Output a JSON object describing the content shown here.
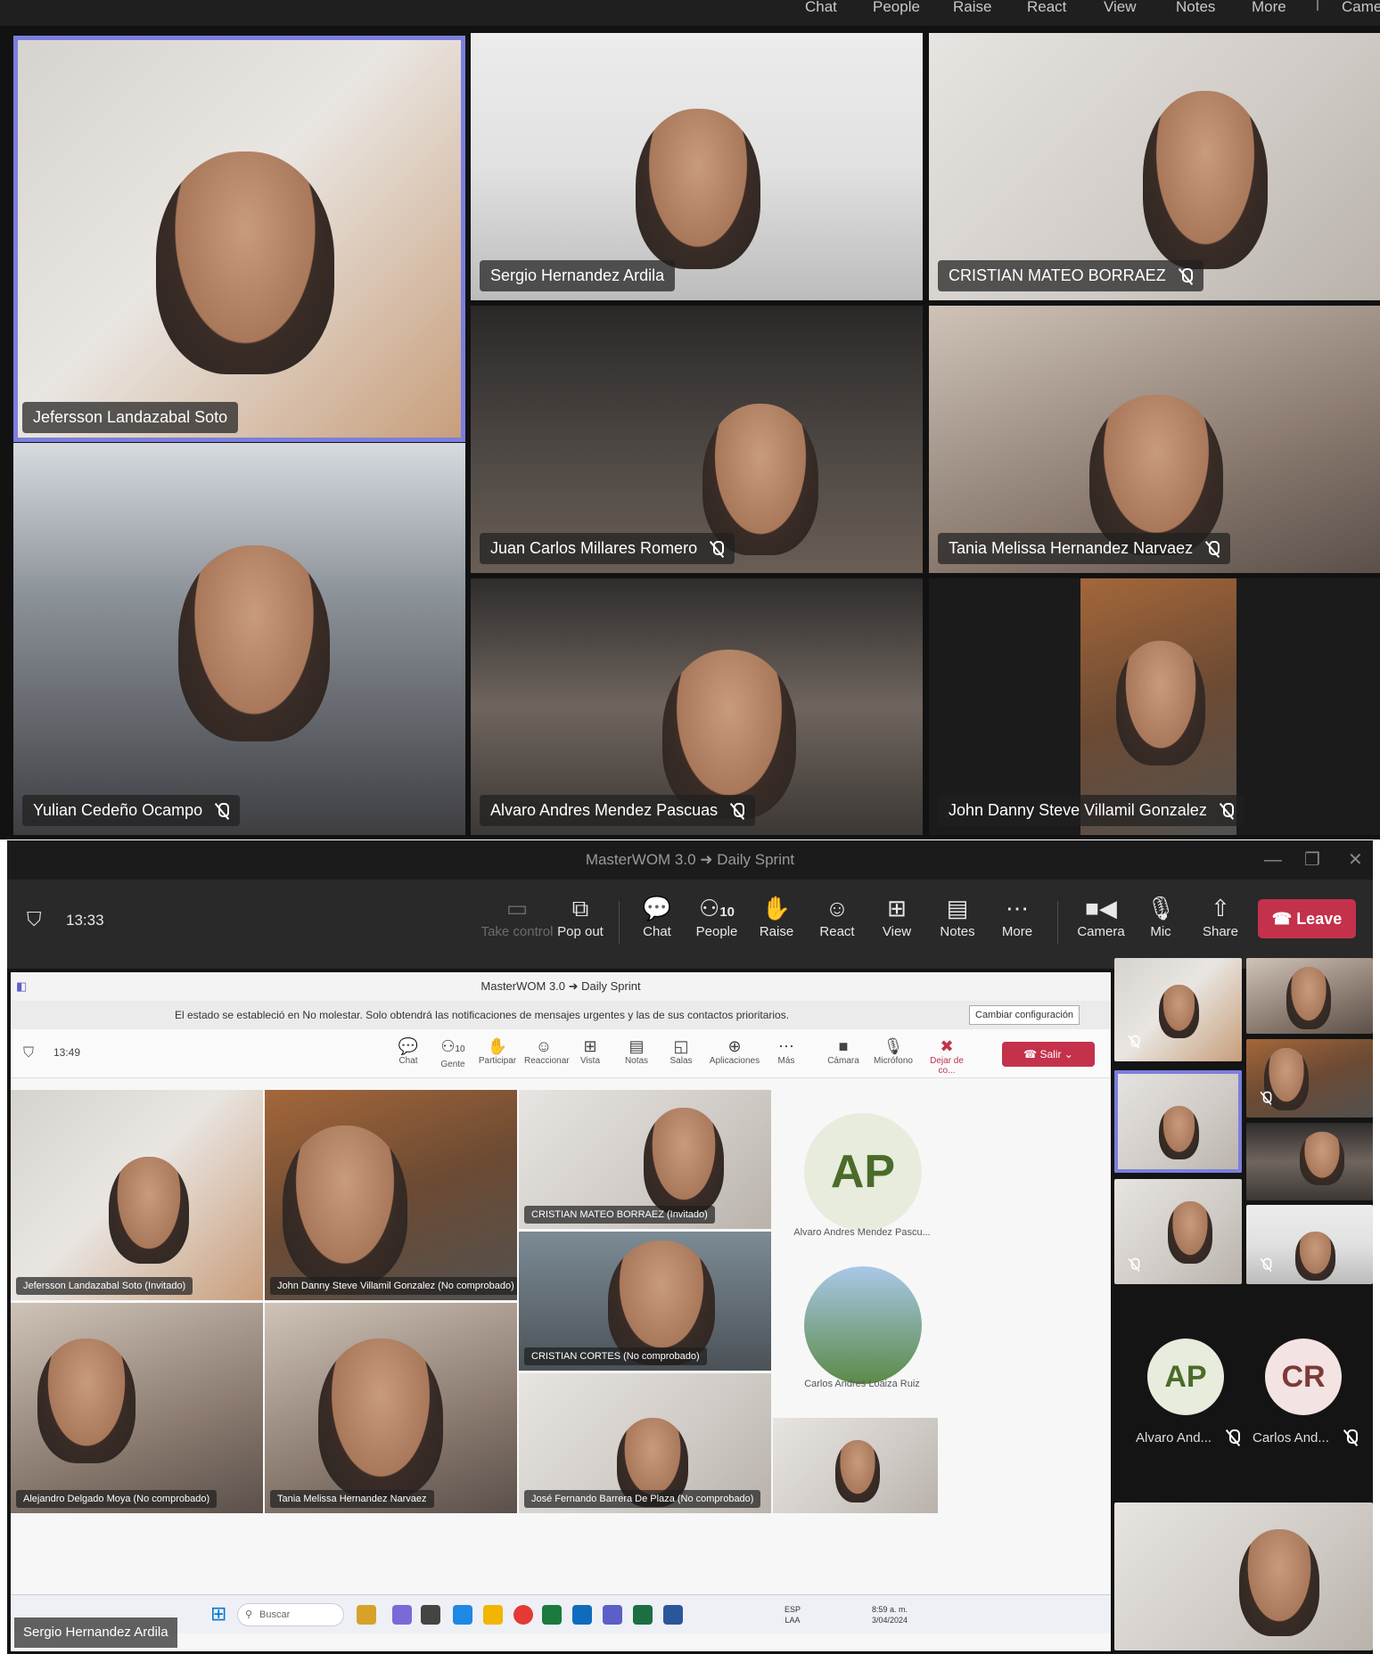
{
  "top_toolbar": {
    "items": [
      "Chat",
      "People",
      "Raise",
      "React",
      "View",
      "Notes",
      "More",
      "Came"
    ]
  },
  "top_grid": {
    "participants": [
      {
        "name": "Jefersson Landazabal Soto",
        "muted": false,
        "active_speaker": true
      },
      {
        "name": "Sergio Hernandez Ardila",
        "muted": false
      },
      {
        "name": "CRISTIAN MATEO BORRAEZ",
        "muted": true
      },
      {
        "name": "Juan Carlos Millares Romero",
        "muted": true
      },
      {
        "name": "Tania Melissa Hernandez Narvaez",
        "muted": true
      },
      {
        "name": "Yulian Cedeño Ocampo",
        "muted": true
      },
      {
        "name": "Alvaro Andres Mendez Pascuas",
        "muted": true
      },
      {
        "name": "John Danny Steve Villamil Gonzalez",
        "muted": true
      }
    ]
  },
  "window": {
    "title": "MasterWOM 3.0 ➜ Daily Sprint",
    "controls": [
      "—",
      "❐",
      "✕"
    ]
  },
  "meeting_toolbar": {
    "timer": "13:33",
    "people_count": "10",
    "buttons": {
      "take_control": "Take control",
      "pop_out": "Pop out",
      "chat": "Chat",
      "people": "People",
      "raise": "Raise",
      "react": "React",
      "view": "View",
      "notes": "Notes",
      "more": "More",
      "camera": "Camera",
      "mic": "Mic",
      "share": "Share",
      "leave": "Leave"
    }
  },
  "shared_screen": {
    "title": "MasterWOM 3.0 ➜ Daily Sprint",
    "banner_text": "El estado se estableció en No molestar. Solo obtendrá las notificaciones de mensajes urgentes y las de sus contactos prioritarios.",
    "banner_button": "Cambiar configuración",
    "timer": "13:49",
    "people_count": "10",
    "toolbar": {
      "chat": "Chat",
      "gente": "Gente",
      "participar": "Participar",
      "reaccionar": "Reaccionar",
      "vista": "Vista",
      "notas": "Notas",
      "salas": "Salas",
      "aplicaciones": "Aplicaciones",
      "mas": "Más",
      "camara": "Cámara",
      "microfono": "Micrófono",
      "dejar": "Dejar de co...",
      "salir": "Salir"
    },
    "tiles": [
      "Jefersson Landazabal Soto (Invitado)",
      "John Danny Steve Villamil Gonzalez (No comprobado)",
      "CRISTIAN MATEO BORRAEZ (Invitado)",
      "CRISTIAN CORTES (No comprobado)",
      "Alejandro Delgado Moya (No comprobado)",
      "Tania Melissa Hernandez Narvaez",
      "José Fernando Barrera De Plaza (No comprobado)"
    ],
    "side_avatars": [
      {
        "initials": "AP",
        "label": "Alvaro Andres Mendez Pascu..."
      },
      {
        "initials": "",
        "label": "Carlos Andres Loaiza Ruiz"
      }
    ],
    "taskbar": {
      "search_placeholder": "Buscar",
      "lang": "ESP",
      "lang2": "LAA",
      "time": "8:59 a. m.",
      "date": "3/04/2024"
    }
  },
  "right_panel": {
    "avatars": [
      {
        "initials": "AP",
        "label": "Alvaro And..."
      },
      {
        "initials": "CR",
        "label": "Carlos And..."
      }
    ]
  },
  "bottom_nameplate": "Sergio Hernandez Ardila",
  "colors": {
    "accent": "#7b7fdd",
    "leave": "#c4314b",
    "toolbar_bg": "#292929"
  }
}
